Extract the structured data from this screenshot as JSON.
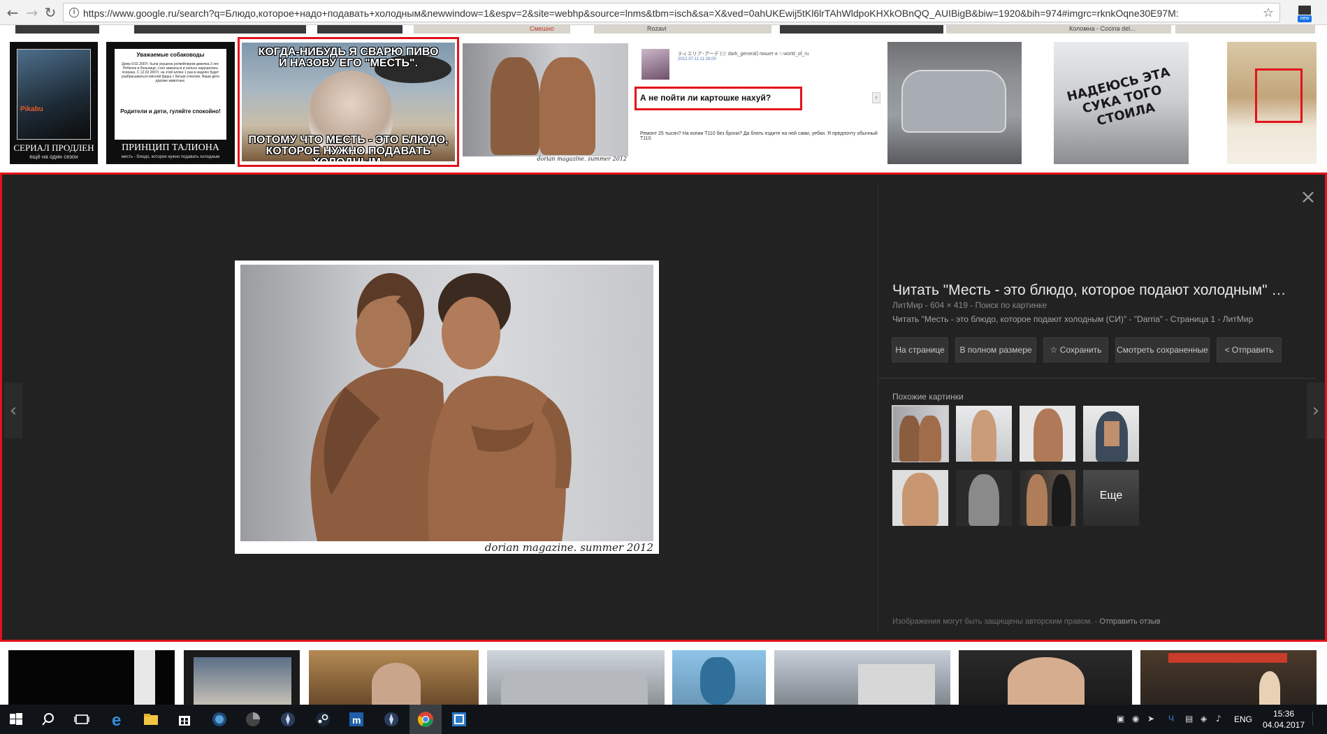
{
  "browser": {
    "url": "https://www.google.ru/search?q=Блюдо,которое+надо+подавать+холодным&newwindow=1&espv=2&site=webhp&source=lnms&tbm=isch&sa=X&ved=0ahUKEwij5tKl6lrTAhWldpoKHXkOBnQQ_AUIBigB&biw=1920&bih=974#imgrc=rknkOqne30E97M:",
    "ext_badge": "new"
  },
  "top_strip": {
    "peeks": [
      "Смешно",
      "Rozavi",
      "Коломна - Cocina del..."
    ],
    "tiles": [
      {
        "caption": "СЕРИАЛ ПРОДЛЕН",
        "subcaption": "ещё на один сезон",
        "badge": "Pikabu"
      },
      {
        "header": "Уважаемые собаководы",
        "body": "Днем 9.02.2007г. была укушена ротвейлером девочка 3 лет. Ребенок в больнице, стал заикаться и сильно нарушилась психика. С 12.02.2007г. на этой аллее 1 раз в неделю будет разбрасываться мясной фарш с битым стеклом. Наши дети дороже животных.",
        "footer": "Родители и дети, гуляйте спокойно!",
        "caption": "ПРИНЦИП ТАЛИОНА",
        "subcaption": "месть - блюдо, которое нужно подавать холодным"
      },
      {
        "top_text": "КОГДА-НИБУДЬ Я СВАРЮ ПИВО И НАЗОВУ ЕГО \"МЕСТЬ\".",
        "bottom_text": "ПОТОМУ ЧТО МЕСТЬ - ЭТО БЛЮДО, КОТОРОЕ НУЖНО ПОДАВАТЬ ХОЛОДНЫМ."
      },
      {
        "caption": "dorian magazine. summer 2012"
      },
      {
        "user_line": "ティエリア･アーデ (☆ dark_general) пишет в ☆world_of_ru",
        "date_line": "2012-07-11 11:26:00",
        "headline": "А не пойти ли картошке нахуй?",
        "body": "Ремонт 25 тысяч? На копии T110 без брони? Да блять ездите на ней сами, уебки. Я предпочту обычный T110."
      },
      {
        "caption": ""
      },
      {
        "car_text": "НАДЕЮСЬ ЭТА СУКА ТОГО СТОИЛА"
      },
      {
        "caption": ""
      }
    ]
  },
  "panel": {
    "main_image_caption": "dorian magazine. summer 2012",
    "title": "Читать \"Месть - это блюдо, которое подают холодным\" (СИ)\" - \"Darria\" - Страница 1 - ЛитМир",
    "meta": "ЛитМир - 604 × 419 - Поиск по картинке",
    "description": "Читать \"Месть - это блюдо, которое подают холодным (СИ)\" - \"Darria\" - Страница 1 - ЛитМир",
    "actions": {
      "visit": "На странице",
      "full_size": "В полном размере",
      "save": "☆ Сохранить",
      "view_saved": "Смотреть сохраненные",
      "share": "Отправить"
    },
    "similar_heading": "Похожие картинки",
    "more_label": "Еще",
    "footer_text": "Изображения могут быть защищены авторским правом.",
    "footer_sep": " - ",
    "feedback": "Отправить отзыв",
    "close_icon": "close-icon",
    "prev_icon": "chevron-left-icon",
    "next_icon": "chevron-right-icon"
  },
  "taskbar": {
    "lang": "ENG",
    "time": "15:36",
    "date": "04.04.2017",
    "tray_letter": "Ч"
  },
  "colors": {
    "highlight": "#e3121b",
    "panel_bg": "#222222",
    "taskbar_bg": "#101418"
  }
}
